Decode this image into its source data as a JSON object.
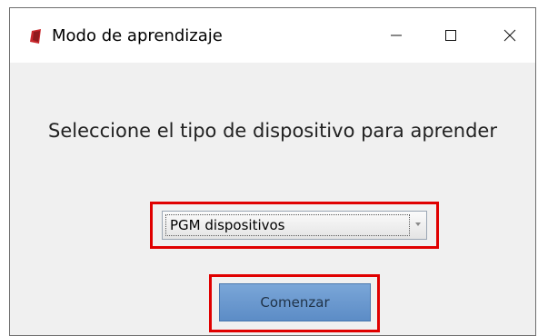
{
  "window": {
    "title": "Modo de aprendizaje",
    "app_icon": "app-icon"
  },
  "title_bar_buttons": {
    "minimize_icon": "minimize-icon",
    "maximize_icon": "maximize-icon",
    "close_icon": "close-icon"
  },
  "main": {
    "prompt": "Seleccione el tipo de dispositivo para aprender",
    "device_select": {
      "selected": "PGM dispositivos",
      "arrow_icon": "chevron-down-icon"
    },
    "start_button_label": "Comenzar"
  },
  "colors": {
    "highlight_border": "#e00000",
    "button_fill": "#6b98cf",
    "window_background": "#f0f0f0"
  }
}
